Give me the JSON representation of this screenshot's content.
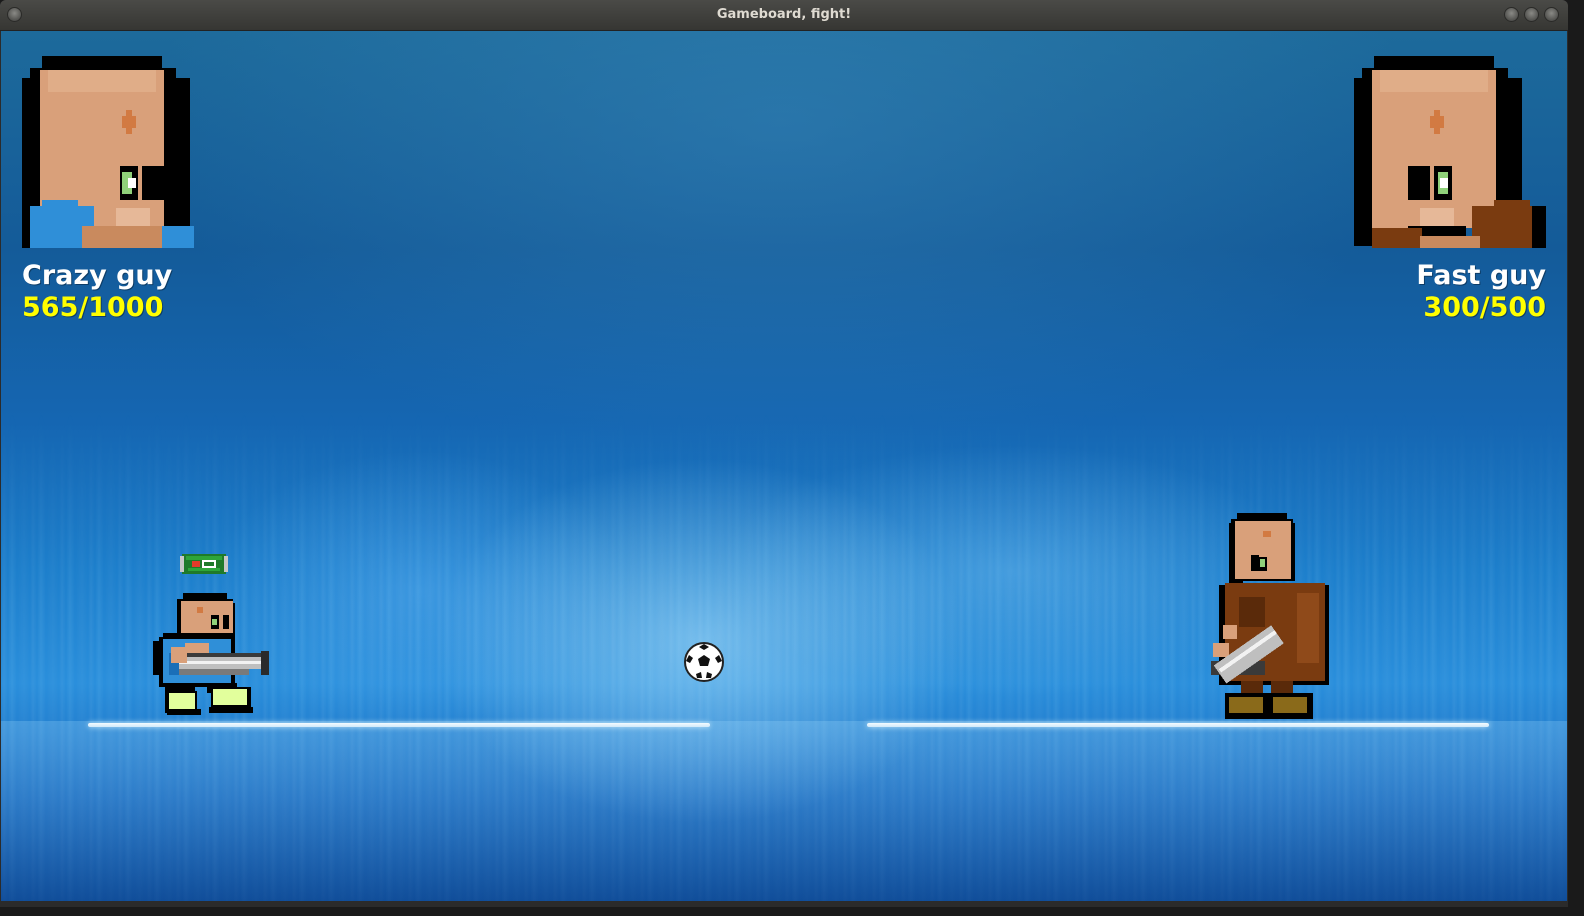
{
  "window": {
    "title": "Gameboard, fight!"
  },
  "players": [
    {
      "name": "Crazy guy",
      "hp_text": "565/1000",
      "hp_current": 565,
      "hp_max": 1000,
      "shirt_color": "#2f8fd8",
      "side": "left"
    },
    {
      "name": "Fast guy",
      "hp_text": "300/500",
      "hp_current": 300,
      "hp_max": 500,
      "shirt_color": "#7a3b10",
      "side": "right"
    }
  ],
  "colors": {
    "name_text": "#ffffff",
    "hp_text": "#ffff00",
    "skin": "#d9a07a",
    "background_accent": "#1b74c4"
  },
  "items": {
    "powerup_icon": "soda-can-icon",
    "ball_icon": "soccer-ball-icon"
  }
}
